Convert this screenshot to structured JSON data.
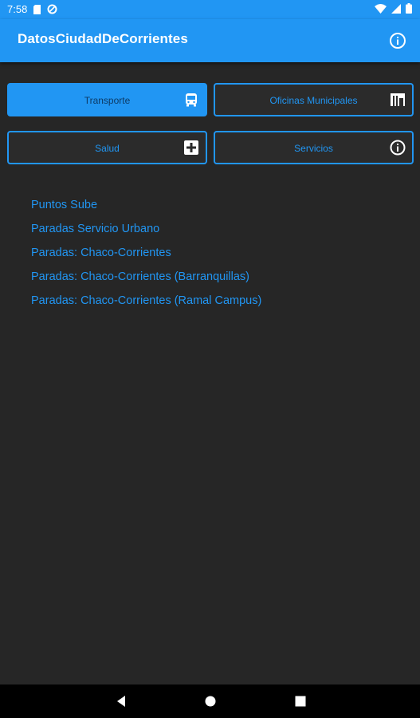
{
  "status_bar": {
    "time": "7:58",
    "icons": [
      "sim-card-icon",
      "data-saver-icon",
      "wifi-icon",
      "signal-icon",
      "battery-icon"
    ]
  },
  "app_bar": {
    "title": "DatosCiudadDeCorrientes",
    "info_icon": "info-icon"
  },
  "categories": [
    {
      "label": "Transporte",
      "icon": "bus-icon",
      "active": true
    },
    {
      "label": "Oficinas Municipales",
      "icon": "building-icon",
      "active": false
    },
    {
      "label": "Salud",
      "icon": "plus-box-icon",
      "active": false
    },
    {
      "label": "Servicios",
      "icon": "info-icon",
      "active": false
    }
  ],
  "links": [
    "Puntos Sube",
    "Paradas Servicio Urbano",
    "Paradas: Chaco-Corrientes",
    "Paradas: Chaco-Corrientes (Barranquillas)",
    "Paradas: Chaco-Corrientes (Ramal Campus)"
  ],
  "nav_bar": [
    "back-icon",
    "home-icon",
    "recents-icon"
  ],
  "colors": {
    "accent": "#2196F3",
    "background": "#262626",
    "active_text": "#0d3b66"
  }
}
